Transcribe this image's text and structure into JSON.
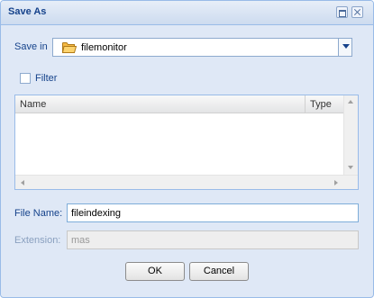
{
  "dialog": {
    "title": "Save As",
    "tools": [
      "maximize-icon",
      "close-icon"
    ]
  },
  "save_in": {
    "label": "Save in",
    "selected": "filemonitor",
    "icon": "folder-icon"
  },
  "filter": {
    "label": "Filter",
    "checked": false
  },
  "file_grid": {
    "columns": [
      "Name",
      "Type"
    ],
    "rows": []
  },
  "file_name": {
    "label": "File Name:",
    "value": "fileindexing"
  },
  "extension": {
    "label": "Extension:",
    "value": "mas"
  },
  "buttons": {
    "ok": "OK",
    "cancel": "Cancel"
  },
  "colors": {
    "panel": "#dfe8f6",
    "border": "#99bbe8",
    "label": "#15428b",
    "folder": "#f5b943"
  }
}
